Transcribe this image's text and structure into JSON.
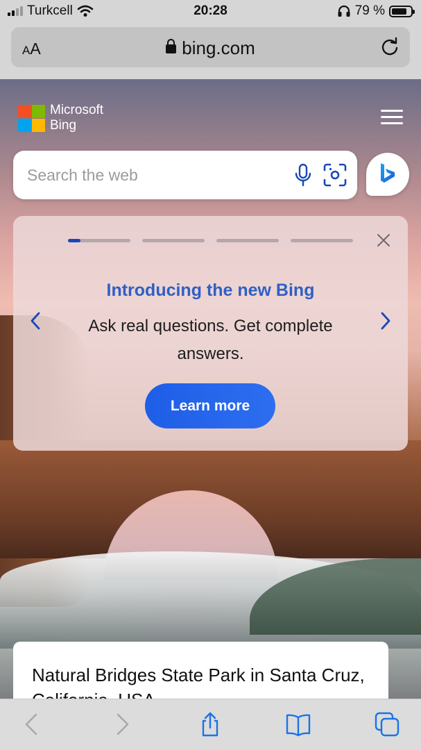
{
  "status_bar": {
    "carrier": "Turkcell",
    "time": "20:28",
    "battery_percent": "79 %",
    "battery_level": 0.79
  },
  "browser": {
    "text_size_label": "AA",
    "url": "bing.com"
  },
  "bing": {
    "logo_line1": "Microsoft",
    "logo_line2": "Bing",
    "search": {
      "placeholder": "Search the web",
      "value": ""
    },
    "promo": {
      "title": "Introducing the new Bing",
      "description": "Ask real questions. Get complete answers.",
      "button_label": "Learn more",
      "slide_count": 4,
      "active_slide": 1,
      "active_slide_progress": 0.2
    },
    "article": {
      "title": "Natural Bridges State Park in Santa Cruz, California, USA"
    }
  },
  "colors": {
    "accent_blue": "#2f5fc4",
    "button_blue": "#1e5ee8",
    "toolbar_icon_blue": "#1a73e8"
  },
  "icons": [
    "wifi-icon",
    "headphones-icon",
    "lock-icon",
    "reload-icon",
    "menu-icon",
    "microphone-icon",
    "visual-search-icon",
    "bing-chat-icon",
    "close-icon",
    "chevron-left-icon",
    "chevron-right-icon",
    "back-icon",
    "forward-icon",
    "share-icon",
    "bookmarks-icon",
    "tabs-icon"
  ]
}
